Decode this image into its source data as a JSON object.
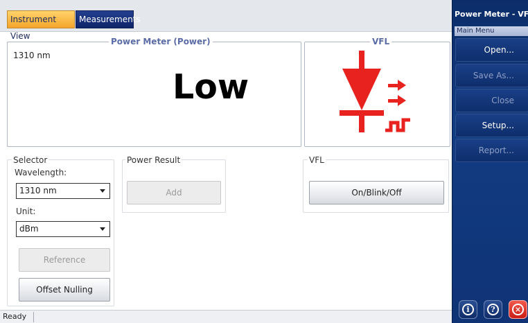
{
  "tabs": [
    {
      "label": "Instrument View",
      "active": true
    },
    {
      "label": "Measurements",
      "active": false
    }
  ],
  "power_meter": {
    "title": "Power Meter (Power)",
    "wavelength": "1310 nm",
    "value": "Low"
  },
  "vfl_display": {
    "title": "VFL",
    "icon": "laser-diode-icon"
  },
  "selector": {
    "title": "Selector",
    "wavelength_label": "Wavelength:",
    "wavelength_value": "1310 nm",
    "unit_label": "Unit:",
    "unit_value": "dBm",
    "reference_label": "Reference",
    "offset_nulling_label": "Offset Nulling"
  },
  "power_result": {
    "title": "Power Result",
    "add_label": "Add"
  },
  "vfl_panel": {
    "title": "VFL",
    "button_label": "On/Blink/Off"
  },
  "status": {
    "text": "Ready"
  },
  "side_menu": {
    "title": "Power Meter - VFL",
    "subtitle": "Main Menu",
    "items": [
      {
        "label": "Open...",
        "enabled": true
      },
      {
        "label": "Save As...",
        "enabled": false
      },
      {
        "label": "Close",
        "enabled": false
      },
      {
        "label": "Setup...",
        "enabled": true
      },
      {
        "label": "Report...",
        "enabled": false
      }
    ],
    "icons": [
      "info-icon",
      "help-icon",
      "close-icon"
    ]
  },
  "colors": {
    "active_tab": "#f4a52a",
    "inactive_tab": "#0f2468",
    "side_panel": "#123c82",
    "vfl_red": "#e8231f",
    "close_button": "#d9261c"
  }
}
